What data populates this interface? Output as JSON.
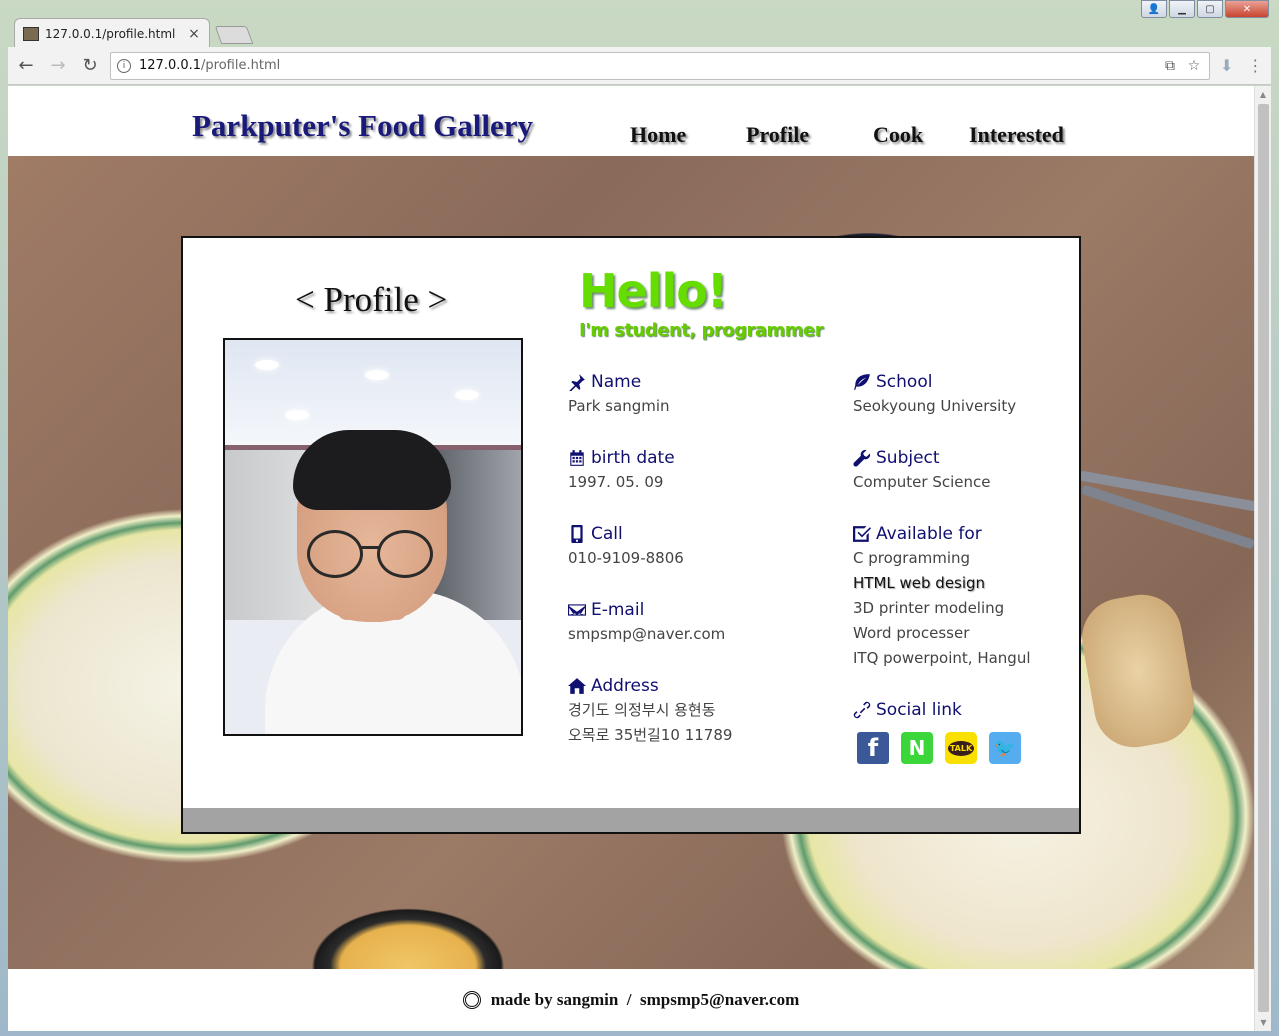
{
  "browser": {
    "tab_title": "127.0.0.1/profile.html",
    "tab_close": "×",
    "url_host": "127.0.0.1",
    "url_path": "/profile.html",
    "icons": [
      "back-icon",
      "forward-icon",
      "reload-icon",
      "info-icon",
      "translate-icon",
      "star-icon",
      "download-icon",
      "menu-icon"
    ]
  },
  "site": {
    "title": "Parkputer's Food Gallery",
    "nav": [
      "Home",
      "Profile",
      "Cook",
      "Interested"
    ]
  },
  "profile": {
    "heading": "< Profile >",
    "hello": "Hello!",
    "subtitle": "I'm student, programmer",
    "left_fields": [
      {
        "icon": "pin-icon",
        "label": "Name",
        "values": [
          "Park sangmin"
        ]
      },
      {
        "icon": "calendar-icon",
        "label": "birth date",
        "values": [
          "1997. 05. 09"
        ]
      },
      {
        "icon": "phone-icon",
        "label": "Call",
        "values": [
          "010-9109-8806"
        ]
      },
      {
        "icon": "envelope-icon",
        "label": "E-mail",
        "values": [
          "smpsmp@naver.com"
        ]
      },
      {
        "icon": "home-icon",
        "label": "Address",
        "values": [
          "경기도 의정부시 용현동",
          "오목로 35번길10 11789"
        ]
      }
    ],
    "right_fields": [
      {
        "icon": "leaf-icon",
        "label": "School",
        "values": [
          "Seokyoung University"
        ]
      },
      {
        "icon": "wrench-icon",
        "label": "Subject",
        "values": [
          "Computer Science"
        ]
      },
      {
        "icon": "checkbox-icon",
        "label": "Available for",
        "values": [
          "C programming",
          "HTML web design",
          "3D printer modeling",
          "Word processer",
          "ITQ powerpoint, Hangul"
        ],
        "highlight_index": 1
      },
      {
        "icon": "link-icon",
        "label": "Social link"
      }
    ],
    "social": [
      {
        "name": "facebook-icon",
        "glyph": "f",
        "color": "#3b5998"
      },
      {
        "name": "naver-icon",
        "glyph": "N",
        "color": "#3ad63a"
      },
      {
        "name": "kakaotalk-icon",
        "glyph": "TALK",
        "color": "#f9e000"
      },
      {
        "name": "twitter-icon",
        "glyph": "🐦",
        "color": "#55acee"
      }
    ]
  },
  "footer": {
    "text": "made by sangmin  /  smpsmp5@naver.com"
  },
  "colors": {
    "title": "#1a1a7a",
    "hello": "#66dd00",
    "label": "#101070",
    "card_footer": "#a3a3a3"
  }
}
